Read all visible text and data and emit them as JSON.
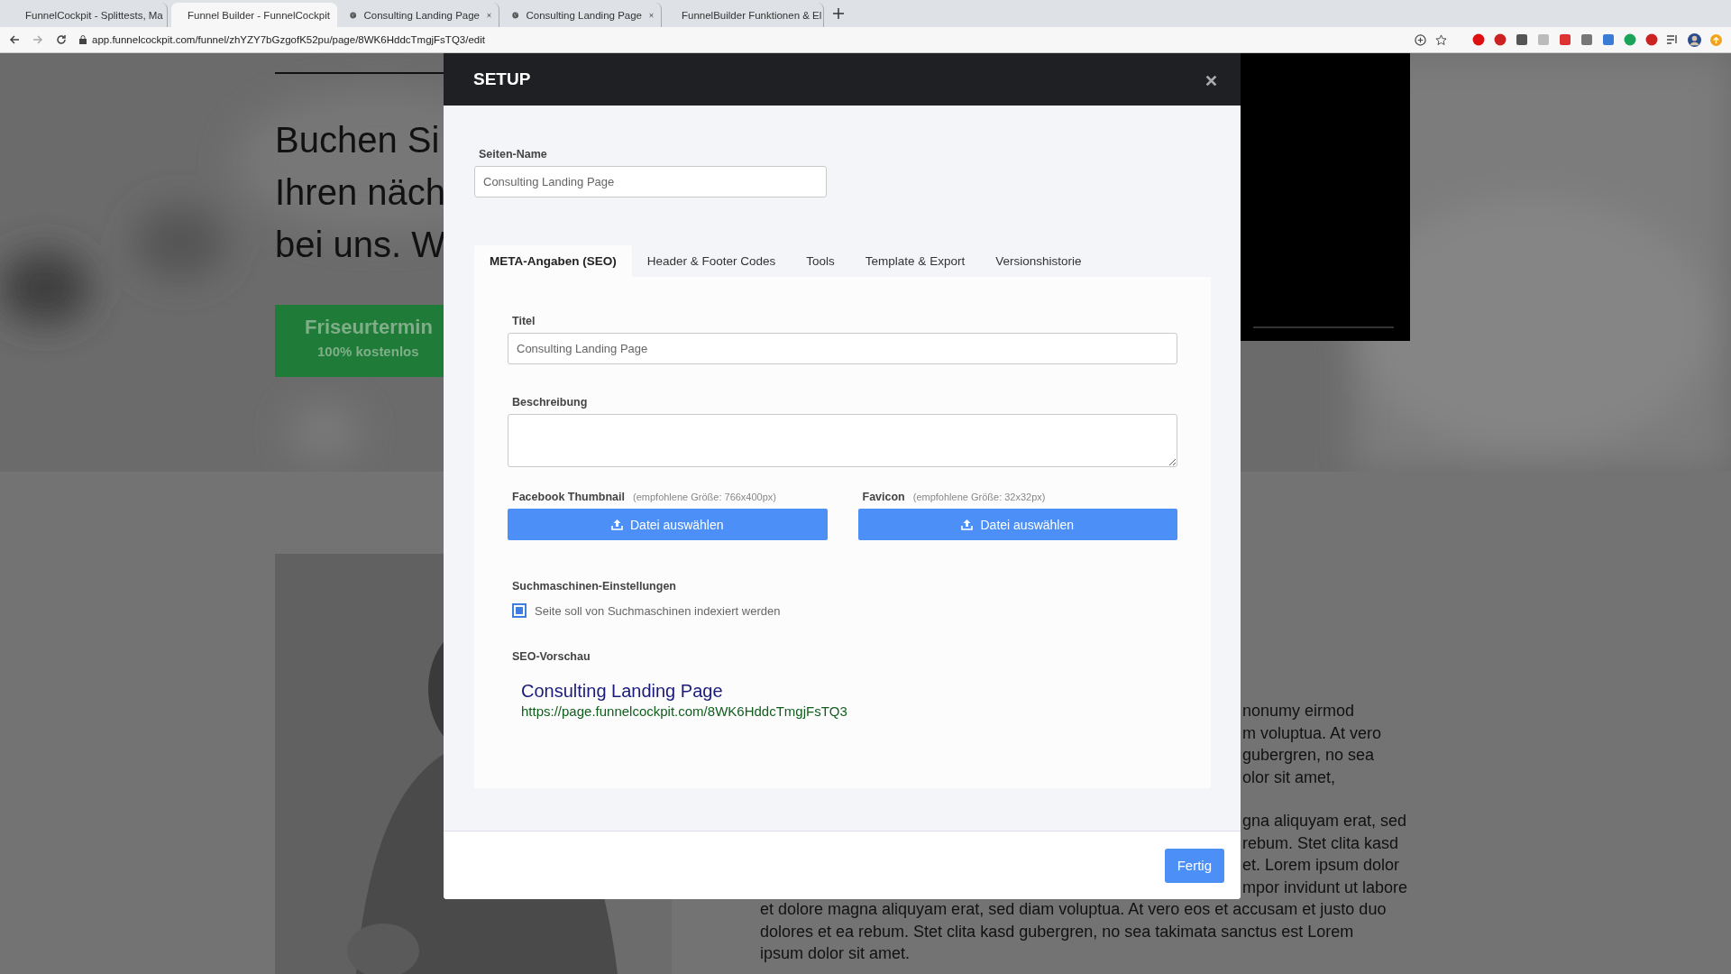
{
  "browser": {
    "tabs": [
      {
        "kind": "funnel",
        "title": "FunnelCockpit - Splittests, Ma",
        "selected": false
      },
      {
        "kind": "funnel",
        "title": "Funnel Builder - FunnelCockpit",
        "selected": true
      },
      {
        "kind": "globe",
        "title": "Consulting Landing Page",
        "selected": false
      },
      {
        "kind": "globe",
        "title": "Consulting Landing Page",
        "selected": false
      },
      {
        "kind": "funnel",
        "title": "FunnelBuilder Funktionen & El",
        "selected": false
      }
    ],
    "address": "app.funnelcockpit.com/funnel/zhYZY7bGzgofK52pu/page/8WK6HddcTmgjFsTQ3/edit"
  },
  "page": {
    "heading_lines": [
      "Buchen Si",
      "Ihren näch",
      "bei uns. W"
    ],
    "cta": {
      "label": "Friseurtermin",
      "sublabel": "100% kostenlos"
    },
    "paragraphs": [
      {
        "lines": [
          {
            "kind": "fragment",
            "text": "nonumy eirmod"
          },
          {
            "kind": "fragment",
            "text": "m voluptua. At vero"
          },
          {
            "kind": "fragment",
            "text": "gubergren, no sea"
          },
          {
            "kind": "fragment",
            "text": "olor sit amet,"
          }
        ]
      },
      {
        "lines": [
          {
            "kind": "fragment",
            "text": "gna aliquyam erat, sed"
          },
          {
            "kind": "fragment",
            "text": "rebum. Stet clita kasd"
          },
          {
            "kind": "fragment",
            "text": "et. Lorem ipsum dolor"
          },
          {
            "kind": "fragment",
            "text": "mpor invidunt ut labore"
          },
          {
            "kind": "full",
            "text": "et dolore magna aliquyam erat, sed diam voluptua. At vero eos et accusam et justo duo"
          },
          {
            "kind": "full",
            "text": "dolores et ea rebum. Stet clita kasd gubergren, no sea takimata sanctus est Lorem"
          },
          {
            "kind": "full",
            "text": "ipsum dolor sit amet."
          }
        ]
      }
    ]
  },
  "modal": {
    "title": "SETUP",
    "page_name": {
      "label": "Seiten-Name",
      "value": "Consulting Landing Page"
    },
    "tabs": [
      {
        "label": "META-Angaben (SEO)",
        "selected": true
      },
      {
        "label": "Header & Footer Codes",
        "selected": false
      },
      {
        "label": "Tools",
        "selected": false
      },
      {
        "label": "Template & Export",
        "selected": false
      },
      {
        "label": "Versionshistorie",
        "selected": false
      }
    ],
    "meta": {
      "title_field": {
        "label": "Titel",
        "value": "Consulting Landing Page"
      },
      "description": {
        "label": "Beschreibung"
      },
      "uploads": [
        {
          "label": "Facebook Thumbnail",
          "hint": "(empfohlene Größe: 766x400px)",
          "button": "Datei auswählen"
        },
        {
          "label": "Favicon",
          "hint": "(empfohlene Größe: 32x32px)",
          "button": "Datei auswählen"
        }
      ],
      "search_engine": {
        "label": "Suchmaschinen-Einstellungen",
        "checkbox": {
          "label": "Seite soll von Suchmaschinen indexiert werden",
          "checked": true
        }
      },
      "preview": {
        "label": "SEO-Vorschau",
        "title": "Consulting Landing Page",
        "url": "https://page.funnelcockpit.com/8WK6HddcTmgjFsTQ3"
      }
    },
    "done_button": "Fertig"
  }
}
